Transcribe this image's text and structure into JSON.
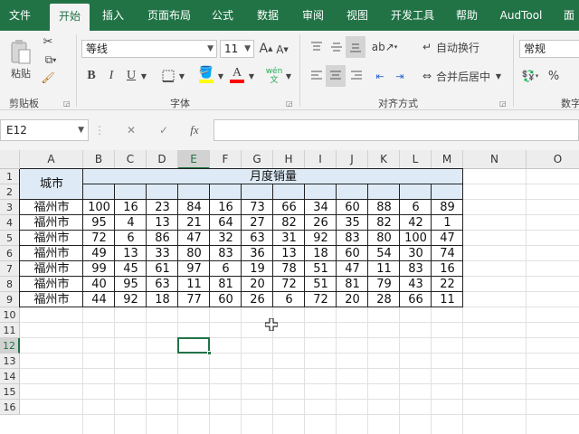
{
  "ribbon_tabs": [
    "文件",
    "开始",
    "插入",
    "页面布局",
    "公式",
    "数据",
    "审阅",
    "视图",
    "开发工具",
    "帮助",
    "AudTool",
    "面"
  ],
  "active_tab": "开始",
  "clipboard": {
    "paste_label": "粘贴",
    "group_label": "剪贴板"
  },
  "font": {
    "name": "等线",
    "size": "11",
    "bold": "B",
    "italic": "I",
    "underline": "U",
    "phonetic": "wén\n文",
    "grow": "A",
    "shrink": "A",
    "group_label": "字体",
    "fill_color": "#ffff00",
    "font_color": "#ff0000"
  },
  "alignment": {
    "wrap_text": "自动换行",
    "merge_center": "合并后居中",
    "group_label": "对齐方式"
  },
  "number": {
    "format": "常规",
    "group_label": "数字"
  },
  "formula_bar": {
    "name_box": "E12",
    "fx": "fx",
    "cancel": "✕",
    "enter": "✓",
    "formula": ""
  },
  "columns": [
    "A",
    "B",
    "C",
    "D",
    "E",
    "F",
    "G",
    "H",
    "I",
    "J",
    "K",
    "L",
    "M",
    "N",
    "O"
  ],
  "selected_column": "E",
  "rows": [
    "1",
    "2",
    "3",
    "4",
    "5",
    "6",
    "7",
    "8",
    "9",
    "10",
    "11",
    "12",
    "13",
    "14",
    "15",
    "16"
  ],
  "selected_row": "12",
  "table": {
    "city_header": "城市",
    "merged_header": "月度销量",
    "rows": [
      {
        "city": "福州市",
        "values": [
          100,
          16,
          23,
          84,
          16,
          73,
          66,
          34,
          60,
          88,
          6,
          89
        ]
      },
      {
        "city": "福州市",
        "values": [
          95,
          4,
          13,
          21,
          64,
          27,
          82,
          26,
          35,
          82,
          42,
          1
        ]
      },
      {
        "city": "福州市",
        "values": [
          72,
          6,
          86,
          47,
          32,
          63,
          31,
          92,
          83,
          80,
          100,
          47
        ]
      },
      {
        "city": "福州市",
        "values": [
          49,
          13,
          33,
          80,
          83,
          36,
          13,
          18,
          60,
          54,
          30,
          74
        ]
      },
      {
        "city": "福州市",
        "values": [
          99,
          45,
          61,
          97,
          6,
          19,
          78,
          51,
          47,
          11,
          83,
          16
        ]
      },
      {
        "city": "福州市",
        "values": [
          40,
          95,
          63,
          11,
          81,
          20,
          72,
          51,
          81,
          79,
          43,
          22
        ]
      },
      {
        "city": "福州市",
        "values": [
          44,
          92,
          18,
          77,
          60,
          26,
          6,
          72,
          20,
          28,
          66,
          11
        ]
      }
    ]
  },
  "colors": {
    "accent": "#217346",
    "header_fill": "#deebf7"
  }
}
